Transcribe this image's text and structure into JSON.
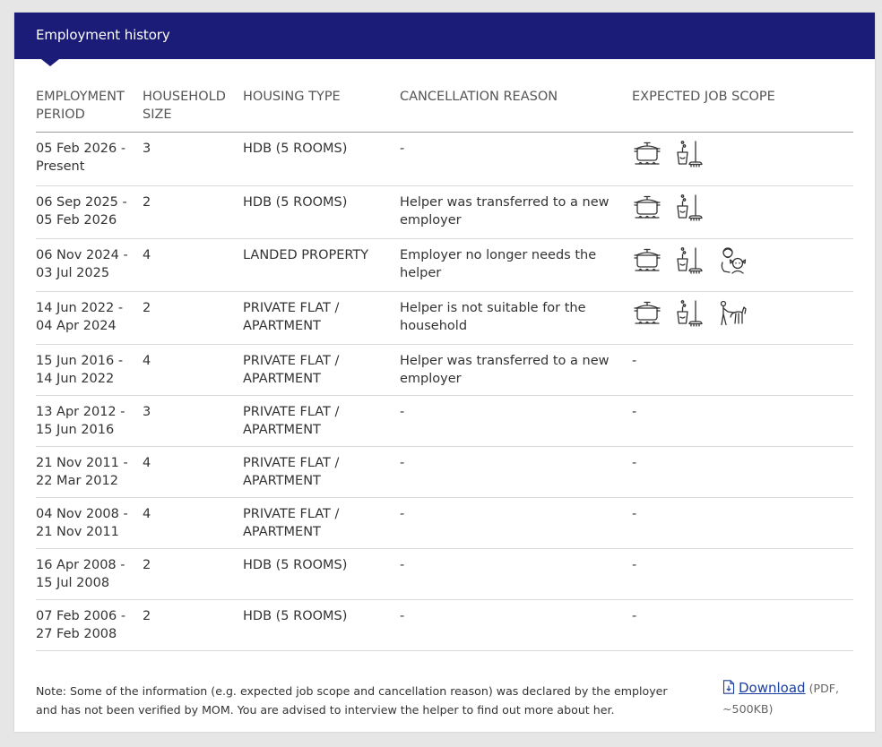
{
  "header": {
    "title": "Employment history"
  },
  "table": {
    "columns": [
      "EMPLOYMENT PERIOD",
      "HOUSEHOLD SIZE",
      "HOUSING TYPE",
      "CANCELLATION REASON",
      "EXPECTED JOB SCOPE"
    ],
    "rows": [
      {
        "period": "05 Feb 2026 - Present",
        "size": "3",
        "housing": "HDB (5 ROOMS)",
        "reason": "-",
        "scope": [
          "cooking-icon",
          "cleaning-icon"
        ]
      },
      {
        "period": "06 Sep 2025 - 05 Feb 2026",
        "size": "2",
        "housing": "HDB (5 ROOMS)",
        "reason": "Helper was transferred to a new employer",
        "scope": [
          "cooking-icon",
          "cleaning-icon"
        ]
      },
      {
        "period": "06 Nov 2024 - 03 Jul 2025",
        "size": "4",
        "housing": "LANDED PROPERTY",
        "reason": "Employer no longer needs the helper",
        "scope": [
          "cooking-icon",
          "cleaning-icon",
          "childcare-icon"
        ]
      },
      {
        "period": "14 Jun 2022 - 04 Apr 2024",
        "size": "2",
        "housing": "PRIVATE FLAT / APARTMENT",
        "reason": "Helper is not suitable for the household",
        "scope": [
          "cooking-icon",
          "cleaning-icon",
          "petcare-icon"
        ]
      },
      {
        "period": "15 Jun 2016 - 14 Jun 2022",
        "size": "4",
        "housing": "PRIVATE FLAT / APARTMENT",
        "reason": "Helper was transferred to a new employer",
        "scope_text": "-"
      },
      {
        "period": "13 Apr 2012 - 15 Jun 2016",
        "size": "3",
        "housing": "PRIVATE FLAT / APARTMENT",
        "reason": "-",
        "scope_text": "-"
      },
      {
        "period": "21 Nov 2011 - 22 Mar 2012",
        "size": "4",
        "housing": "PRIVATE FLAT / APARTMENT",
        "reason": "-",
        "scope_text": "-"
      },
      {
        "period": "04 Nov 2008 - 21 Nov 2011",
        "size": "4",
        "housing": "PRIVATE FLAT / APARTMENT",
        "reason": "-",
        "scope_text": "-"
      },
      {
        "period": "16 Apr 2008 - 15 Jul 2008",
        "size": "2",
        "housing": "HDB (5 ROOMS)",
        "reason": "-",
        "scope_text": "-"
      },
      {
        "period": "07 Feb 2006 - 27 Feb 2008",
        "size": "2",
        "housing": "HDB (5 ROOMS)",
        "reason": "-",
        "scope_text": "-"
      }
    ]
  },
  "footer": {
    "note": "Note: Some of the information (e.g. expected job scope and cancellation reason) was declared by the employer and has not been verified by MOM. You are advised to interview the helper to find out more about her.",
    "download_label": "Download",
    "download_meta": "(PDF, ~500KB)",
    "download_icon": "document-icon"
  },
  "colors": {
    "header_bg": "#1b1b78",
    "link": "#1b3fa0",
    "page_bg": "#e6e6e6"
  }
}
